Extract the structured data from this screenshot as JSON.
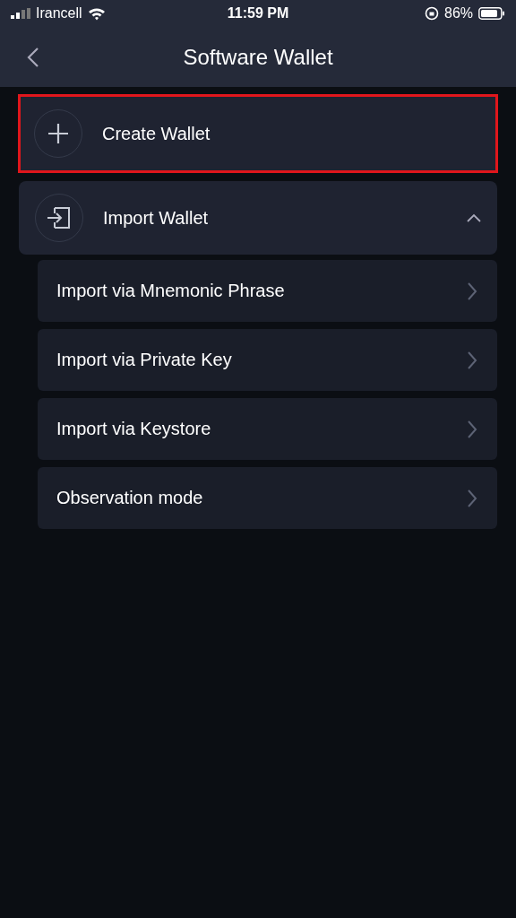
{
  "status_bar": {
    "carrier": "Irancell",
    "time": "11:59 PM",
    "battery": "86%"
  },
  "header": {
    "title": "Software Wallet"
  },
  "sections": [
    {
      "kind": "create",
      "label": "Create Wallet",
      "highlighted": true
    },
    {
      "kind": "import",
      "label": "Import Wallet",
      "expanded": true,
      "children": [
        {
          "label": "Import via Mnemonic Phrase"
        },
        {
          "label": "Import via Private Key"
        },
        {
          "label": "Import via Keystore"
        },
        {
          "label": "Observation mode"
        }
      ]
    }
  ]
}
